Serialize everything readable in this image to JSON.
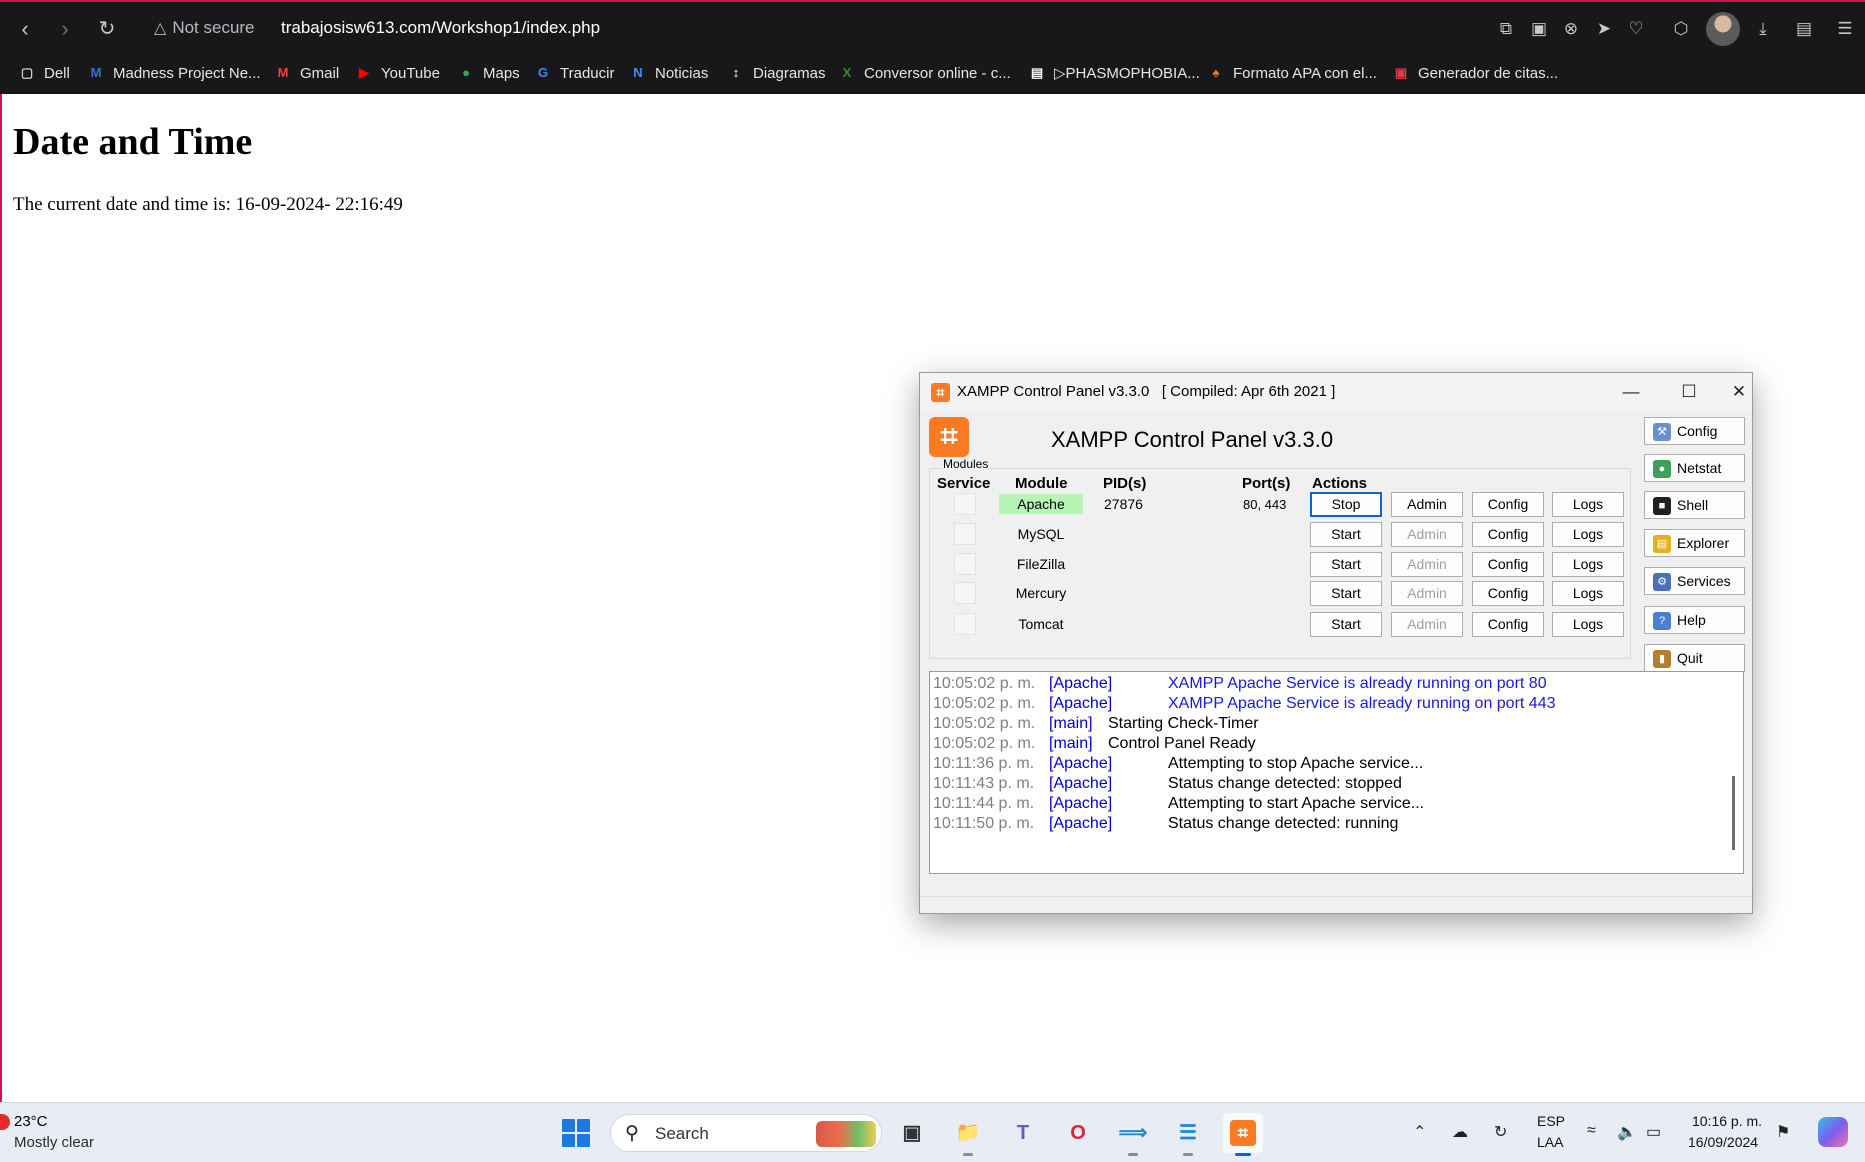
{
  "browser": {
    "security_label": "Not secure",
    "url": "trabajosisw613.com/Workshop1/index.php",
    "icons": [
      "back-icon",
      "forward-icon",
      "reload-icon",
      "warning-icon",
      "share-icon",
      "camera-icon",
      "extension-icon",
      "send-icon",
      "heart-icon",
      "cube-icon",
      "download-icon",
      "sidebar-icon",
      "menu-icon"
    ]
  },
  "bookmarks": [
    {
      "label": "Dell",
      "icon": "folder-icon",
      "color": "#cfcfcf"
    },
    {
      "label": "Madness Project Ne...",
      "icon": "m-logo-icon",
      "color": "#3a6fd8"
    },
    {
      "label": "Gmail",
      "icon": "gmail-icon",
      "color": "#ea4335"
    },
    {
      "label": "YouTube",
      "icon": "youtube-icon",
      "color": "#ff0000"
    },
    {
      "label": "Maps",
      "icon": "maps-icon",
      "color": "#34a853"
    },
    {
      "label": "Traducir",
      "icon": "translate-icon",
      "color": "#4285f4"
    },
    {
      "label": "Noticias",
      "icon": "news-icon",
      "color": "#4a8af4"
    },
    {
      "label": "Diagramas",
      "icon": "diagram-icon",
      "color": "#ffffff"
    },
    {
      "label": "Conversor online - c...",
      "icon": "converter-icon",
      "color": "#2e8b2e"
    },
    {
      "label": "▷PHASMOPHOBIA...",
      "icon": "document-icon",
      "color": "#ffffff"
    },
    {
      "label": "Formato APA con el...",
      "icon": "apa-icon",
      "color": "#f07a2a"
    },
    {
      "label": "Generador de citas...",
      "icon": "citation-icon",
      "color": "#d94040"
    }
  ],
  "page": {
    "title": "Date and Time",
    "text": "The current date and time is: 16-09-2024- 22:16:49"
  },
  "xampp": {
    "window_title": "XAMPP Control Panel v3.3.0   [ Compiled: Apr 6th 2021 ]",
    "heading": "XAMPP Control Panel v3.3.0",
    "modules_label": "Modules",
    "columns": {
      "service": "Service",
      "module": "Module",
      "pid": "PID(s)",
      "port": "Port(s)",
      "actions": "Actions"
    },
    "modules": [
      {
        "name": "Apache",
        "pid": "27876",
        "port": "80, 443",
        "start_stop": "Stop",
        "admin": "Admin",
        "config": "Config",
        "logs": "Logs",
        "running": true
      },
      {
        "name": "MySQL",
        "pid": "",
        "port": "",
        "start_stop": "Start",
        "admin": "Admin",
        "config": "Config",
        "logs": "Logs",
        "running": false
      },
      {
        "name": "FileZilla",
        "pid": "",
        "port": "",
        "start_stop": "Start",
        "admin": "Admin",
        "config": "Config",
        "logs": "Logs",
        "running": false
      },
      {
        "name": "Mercury",
        "pid": "",
        "port": "",
        "start_stop": "Start",
        "admin": "Admin",
        "config": "Config",
        "logs": "Logs",
        "running": false
      },
      {
        "name": "Tomcat",
        "pid": "",
        "port": "",
        "start_stop": "Start",
        "admin": "Admin",
        "config": "Config",
        "logs": "Logs",
        "running": false
      }
    ],
    "side_buttons": [
      {
        "label": "Config",
        "icon": "wrench-icon"
      },
      {
        "label": "Netstat",
        "icon": "globe-icon"
      },
      {
        "label": "Shell",
        "icon": "terminal-icon"
      },
      {
        "label": "Explorer",
        "icon": "folder-icon"
      },
      {
        "label": "Services",
        "icon": "services-icon"
      },
      {
        "label": "Help",
        "icon": "help-icon"
      },
      {
        "label": "Quit",
        "icon": "door-icon"
      }
    ],
    "log": [
      {
        "time": "10:05:02 p. m.",
        "source": "[Apache]",
        "message": "XAMPP Apache Service is already running on port 80",
        "highlight": true
      },
      {
        "time": "10:05:02 p. m.",
        "source": "[Apache]",
        "message": "XAMPP Apache Service is already running on port 443",
        "highlight": true
      },
      {
        "time": "10:05:02 p. m.",
        "source": "[main]",
        "message": "Starting Check-Timer",
        "highlight": false
      },
      {
        "time": "10:05:02 p. m.",
        "source": "[main]",
        "message": "Control Panel Ready",
        "highlight": false
      },
      {
        "time": "10:11:36 p. m.",
        "source": "[Apache]",
        "message": "Attempting to stop Apache service...",
        "highlight": false
      },
      {
        "time": "10:11:43 p. m.",
        "source": "[Apache]",
        "message": "Status change detected: stopped",
        "highlight": false
      },
      {
        "time": "10:11:44 p. m.",
        "source": "[Apache]",
        "message": "Attempting to start Apache service...",
        "highlight": false
      },
      {
        "time": "10:11:50 p. m.",
        "source": "[Apache]",
        "message": "Status change detected: running",
        "highlight": false
      }
    ]
  },
  "taskbar": {
    "weather_temp": "23°C",
    "weather_desc": "Mostly clear",
    "search_label": "Search",
    "apps": [
      "file-explorer-icon",
      "task-view-icon",
      "folder-icon",
      "teams-icon",
      "opera-icon",
      "vscode-icon",
      "notepad-icon",
      "xampp-icon"
    ],
    "lang_1": "ESP",
    "lang_2": "LAA",
    "time": "10:16 p. m.",
    "date": "16/09/2024"
  },
  "colors": {
    "browser_bg": "#18181b",
    "accent_pink": "#c9184a",
    "xampp_orange": "#fb7a24",
    "running_green": "#b5f5b5",
    "log_blue": "#1a1adc",
    "taskbar_bg": "#e8edf5"
  }
}
